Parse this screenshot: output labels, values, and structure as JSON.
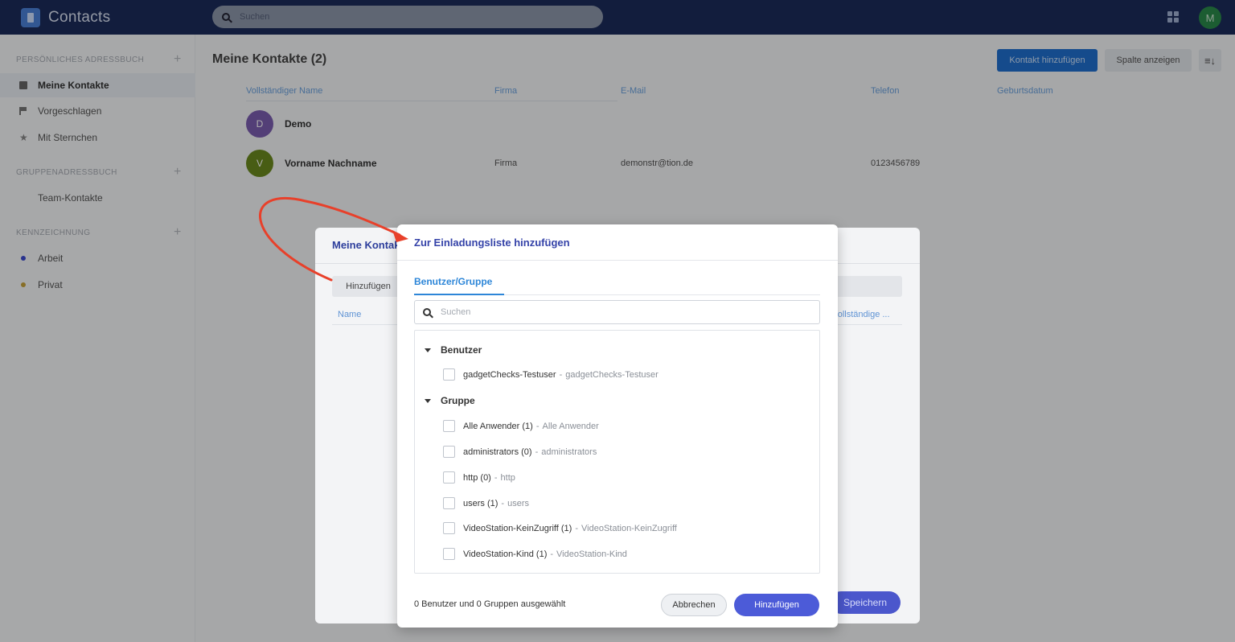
{
  "app": {
    "title": "Contacts",
    "search_placeholder": "Suchen",
    "user_initial": "M"
  },
  "sidebar": {
    "sections": [
      {
        "label": "PERSÖNLICHES ADRESSBUCH"
      },
      {
        "label": "GRUPPENADRESSBUCH"
      },
      {
        "label": "KENNZEICHNUNG"
      }
    ],
    "items": [
      {
        "label": "Meine Kontakte",
        "icon": "address-book-icon",
        "active": true
      },
      {
        "label": "Vorgeschlagen",
        "icon": "flag-icon"
      },
      {
        "label": "Mit Sternchen",
        "icon": "star-icon"
      },
      {
        "label": "Team-Kontakte"
      },
      {
        "label": "Arbeit",
        "icon": "label-dot-icon",
        "color": "#3d4bd0"
      },
      {
        "label": "Privat",
        "icon": "label-dot-icon",
        "color": "#c7a23a"
      }
    ]
  },
  "main": {
    "title": "Meine Kontakte (2)",
    "add_contact": "Kontakt hinzufügen",
    "show_columns": "Spalte anzeigen",
    "sort_glyph": "≡↓",
    "columns": [
      "Vollständiger Name",
      "Firma",
      "E-Mail",
      "Telefon",
      "Geburtsdatum"
    ],
    "rows": [
      {
        "initial": "D",
        "name": "Demo",
        "company": "",
        "email": "",
        "phone": "",
        "avatar_color": "#7b5db0"
      },
      {
        "initial": "V",
        "name": "Vorname Nachname",
        "company": "Firma",
        "email": "demonstr@tion.de",
        "phone": "0123456789",
        "avatar_color": "#6a8a1e"
      }
    ]
  },
  "back_dialog": {
    "title": "Meine Kontakte",
    "add_button": "Hinzufügen",
    "col_name": "Name",
    "col_full": "Vollständige ...",
    "save": "Speichern"
  },
  "dialog": {
    "title": "Zur Einladungsliste hinzufügen",
    "tab": "Benutzer/Gruppe",
    "search_placeholder": "Suchen",
    "groups": [
      {
        "label": "Benutzer",
        "options": [
          {
            "name": "gadgetChecks-Testuser",
            "sub": "gadgetChecks-Testuser"
          }
        ]
      },
      {
        "label": "Gruppe",
        "options": [
          {
            "name": "Alle Anwender (1)",
            "sub": "Alle Anwender"
          },
          {
            "name": "administrators (0)",
            "sub": "administrators"
          },
          {
            "name": "http (0)",
            "sub": "http"
          },
          {
            "name": "users (1)",
            "sub": "users"
          },
          {
            "name": "VideoStation-KeinZugriff (1)",
            "sub": "VideoStation-KeinZugriff"
          },
          {
            "name": "VideoStation-Kind (1)",
            "sub": "VideoStation-Kind"
          }
        ]
      }
    ],
    "separator": "-",
    "status": "0 Benutzer und 0 Gruppen ausgewählt",
    "cancel": "Abbrechen",
    "confirm": "Hinzufügen"
  },
  "annotation": {
    "color": "#e8402a"
  }
}
